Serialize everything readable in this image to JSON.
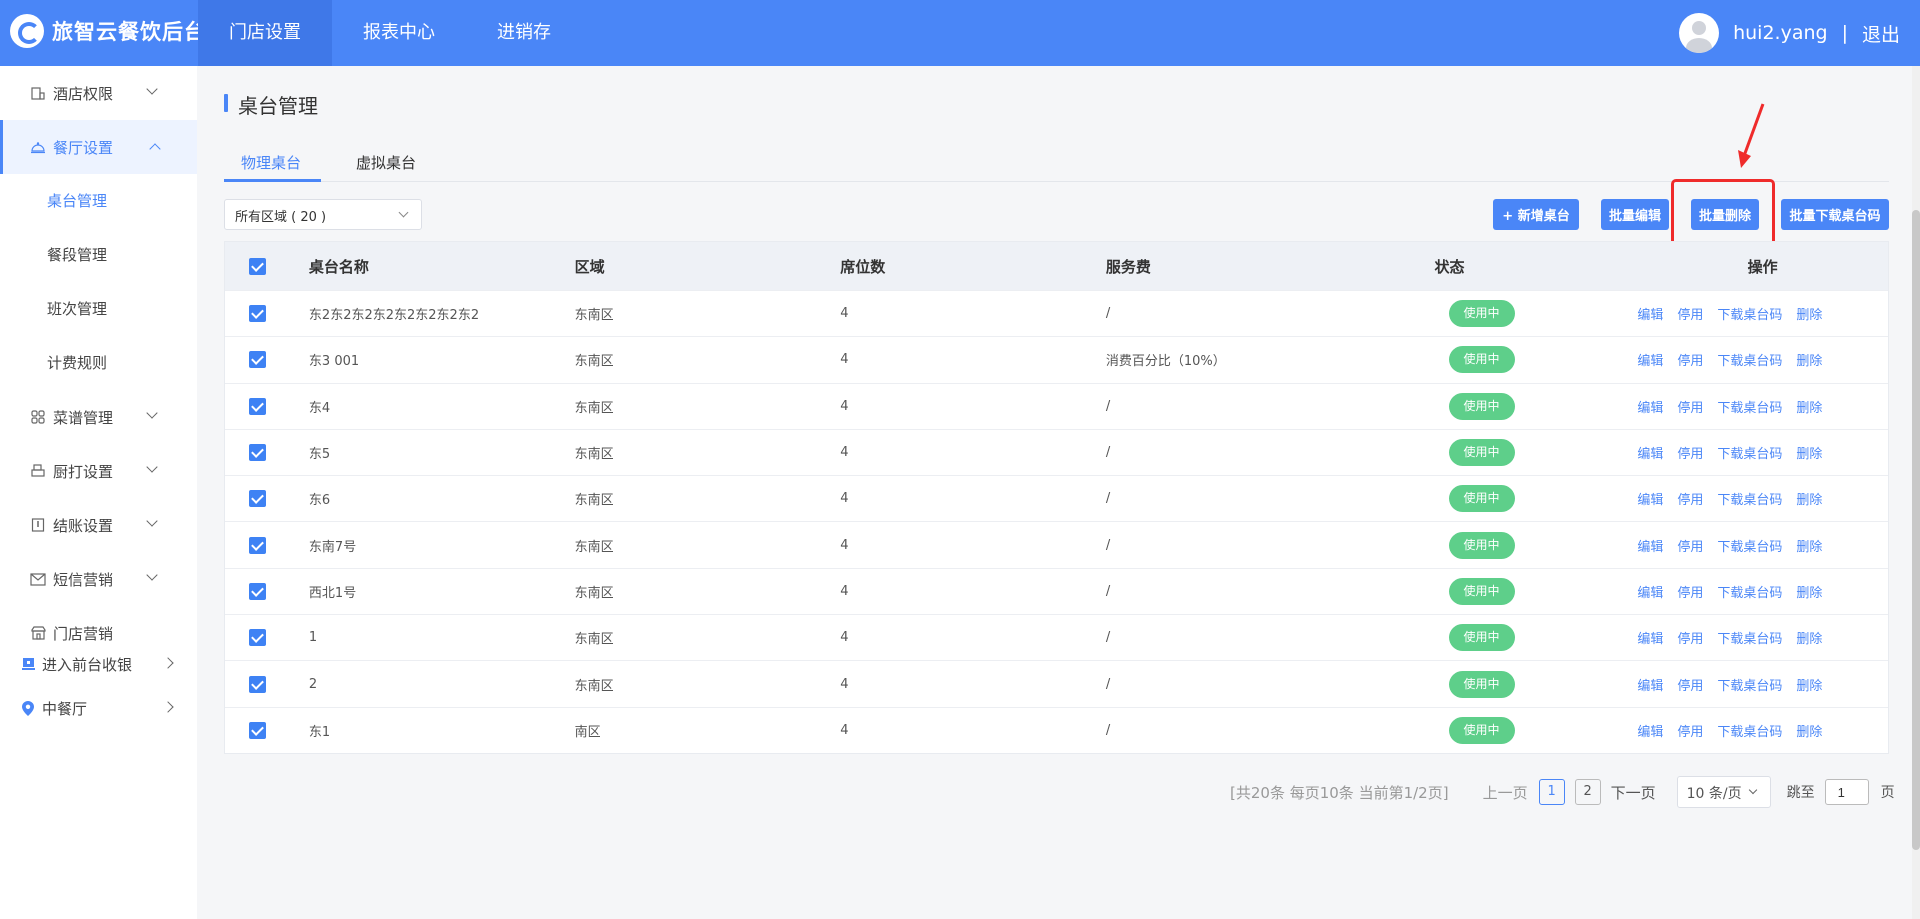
{
  "header": {
    "app_title": "旅智云餐饮后台",
    "nav": [
      "门店设置",
      "报表中心",
      "进销存"
    ],
    "username": "hui2.yang",
    "separator": "|",
    "logout": "退出"
  },
  "sidebar": {
    "items": [
      {
        "label": "酒店权限",
        "icon": "hotel-icon"
      },
      {
        "label": "餐厅设置",
        "icon": "restaurant-icon"
      },
      {
        "label": "菜谱管理",
        "icon": "grid-icon"
      },
      {
        "label": "厨打设置",
        "icon": "printer-icon"
      },
      {
        "label": "结账设置",
        "icon": "billing-icon"
      },
      {
        "label": "短信营销",
        "icon": "mail-icon"
      },
      {
        "label": "门店营销",
        "icon": "store-icon"
      }
    ],
    "sub_items": [
      "桌台管理",
      "餐段管理",
      "班次管理",
      "计费规则"
    ],
    "bottom": [
      {
        "label": "进入前台收银",
        "icon": "cashier-icon"
      },
      {
        "label": "中餐厅",
        "icon": "location-pin-icon"
      }
    ]
  },
  "page": {
    "title": "桌台管理",
    "tabs": [
      "物理桌台",
      "虚拟桌台"
    ],
    "filter": "所有区域 ( 20 )",
    "buttons": {
      "add": "+ 新增桌台",
      "batch_edit": "批量编辑",
      "batch_delete": "批量删除",
      "batch_download": "批量下载桌台码"
    }
  },
  "table": {
    "headers": [
      "桌台名称",
      "区域",
      "席位数",
      "服务费",
      "状态",
      "操作"
    ],
    "ops": [
      "编辑",
      "停用",
      "下载桌台码",
      "删除"
    ],
    "rows": [
      {
        "name": "东2东2东2东2东2东2东2东2",
        "area": "东南区",
        "seats": "4",
        "fee": "/",
        "status": "使用中"
      },
      {
        "name": "东3 001",
        "area": "东南区",
        "seats": "4",
        "fee": "消费百分比（10%）",
        "status": "使用中"
      },
      {
        "name": "东4",
        "area": "东南区",
        "seats": "4",
        "fee": "/",
        "status": "使用中"
      },
      {
        "name": "东5",
        "area": "东南区",
        "seats": "4",
        "fee": "/",
        "status": "使用中"
      },
      {
        "name": "东6",
        "area": "东南区",
        "seats": "4",
        "fee": "/",
        "status": "使用中"
      },
      {
        "name": "东南7号",
        "area": "东南区",
        "seats": "4",
        "fee": "/",
        "status": "使用中"
      },
      {
        "name": "西北1号",
        "area": "东南区",
        "seats": "4",
        "fee": "/",
        "status": "使用中"
      },
      {
        "name": "1",
        "area": "东南区",
        "seats": "4",
        "fee": "/",
        "status": "使用中"
      },
      {
        "name": "2",
        "area": "东南区",
        "seats": "4",
        "fee": "/",
        "status": "使用中"
      },
      {
        "name": "东1",
        "area": "南区",
        "seats": "4",
        "fee": "/",
        "status": "使用中"
      }
    ]
  },
  "pagination": {
    "info": "[共20条 每页10条 当前第1/2页]",
    "prev": "上一页",
    "pages": [
      "1",
      "2"
    ],
    "next": "下一页",
    "page_size": "10 条/页",
    "jump_label": "跳至",
    "jump_value": "1",
    "page_suffix": "页"
  },
  "colors": {
    "accent": "#4a86f7",
    "status_green": "#5ecf8a",
    "highlight_red": "#ef2b2b"
  }
}
